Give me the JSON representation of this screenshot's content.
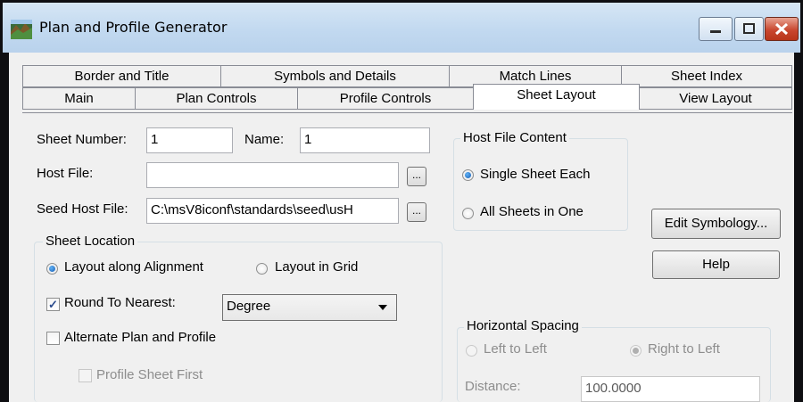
{
  "window": {
    "title": "Plan and Profile Generator",
    "minimize_icon": "minimize-icon",
    "maximize_icon": "maximize-icon",
    "close_icon": "close-icon",
    "app_icon": "plan-profile-app-icon"
  },
  "tabs": {
    "row1": [
      "Border and Title",
      "Symbols and Details",
      "Match Lines",
      "Sheet Index"
    ],
    "row2": [
      "Main",
      "Plan Controls",
      "Profile Controls",
      "Sheet Layout",
      "View Layout"
    ],
    "active": "Sheet Layout"
  },
  "sheet": {
    "number_label": "Sheet Number:",
    "number_value": "1",
    "name_label": "Name:",
    "name_value": "1",
    "host_file_label": "Host File:",
    "host_file_value": "",
    "seed_host_file_label": "Seed Host File:",
    "seed_host_file_value": "C:\\msV8iconf\\standards\\seed\\usH",
    "browse_label": "..."
  },
  "sheet_location": {
    "title": "Sheet Location",
    "layout_alignment": "Layout along Alignment",
    "layout_grid": "Layout in Grid",
    "selected": "Layout along Alignment",
    "round_label": "Round To Nearest:",
    "round_checked": true,
    "round_value": "Degree",
    "alternate_label": "Alternate Plan and Profile",
    "alternate_checked": false,
    "profile_first_label": "Profile Sheet First",
    "profile_first_checked": false
  },
  "host_content": {
    "title": "Host File Content",
    "single": "Single Sheet Each",
    "all": "All Sheets in One",
    "selected": "Single Sheet Each"
  },
  "buttons": {
    "edit_symbology": "Edit Symbology...",
    "help": "Help"
  },
  "horizontal_spacing": {
    "title": "Horizontal Spacing",
    "left_to_left": "Left to Left",
    "right_to_left": "Right to Left",
    "selected": "Right to Left",
    "distance_label": "Distance:",
    "distance_value": "100.0000"
  },
  "icons": {
    "dropdown": "chevron-down-icon",
    "checkmark": "checkmark-icon"
  }
}
